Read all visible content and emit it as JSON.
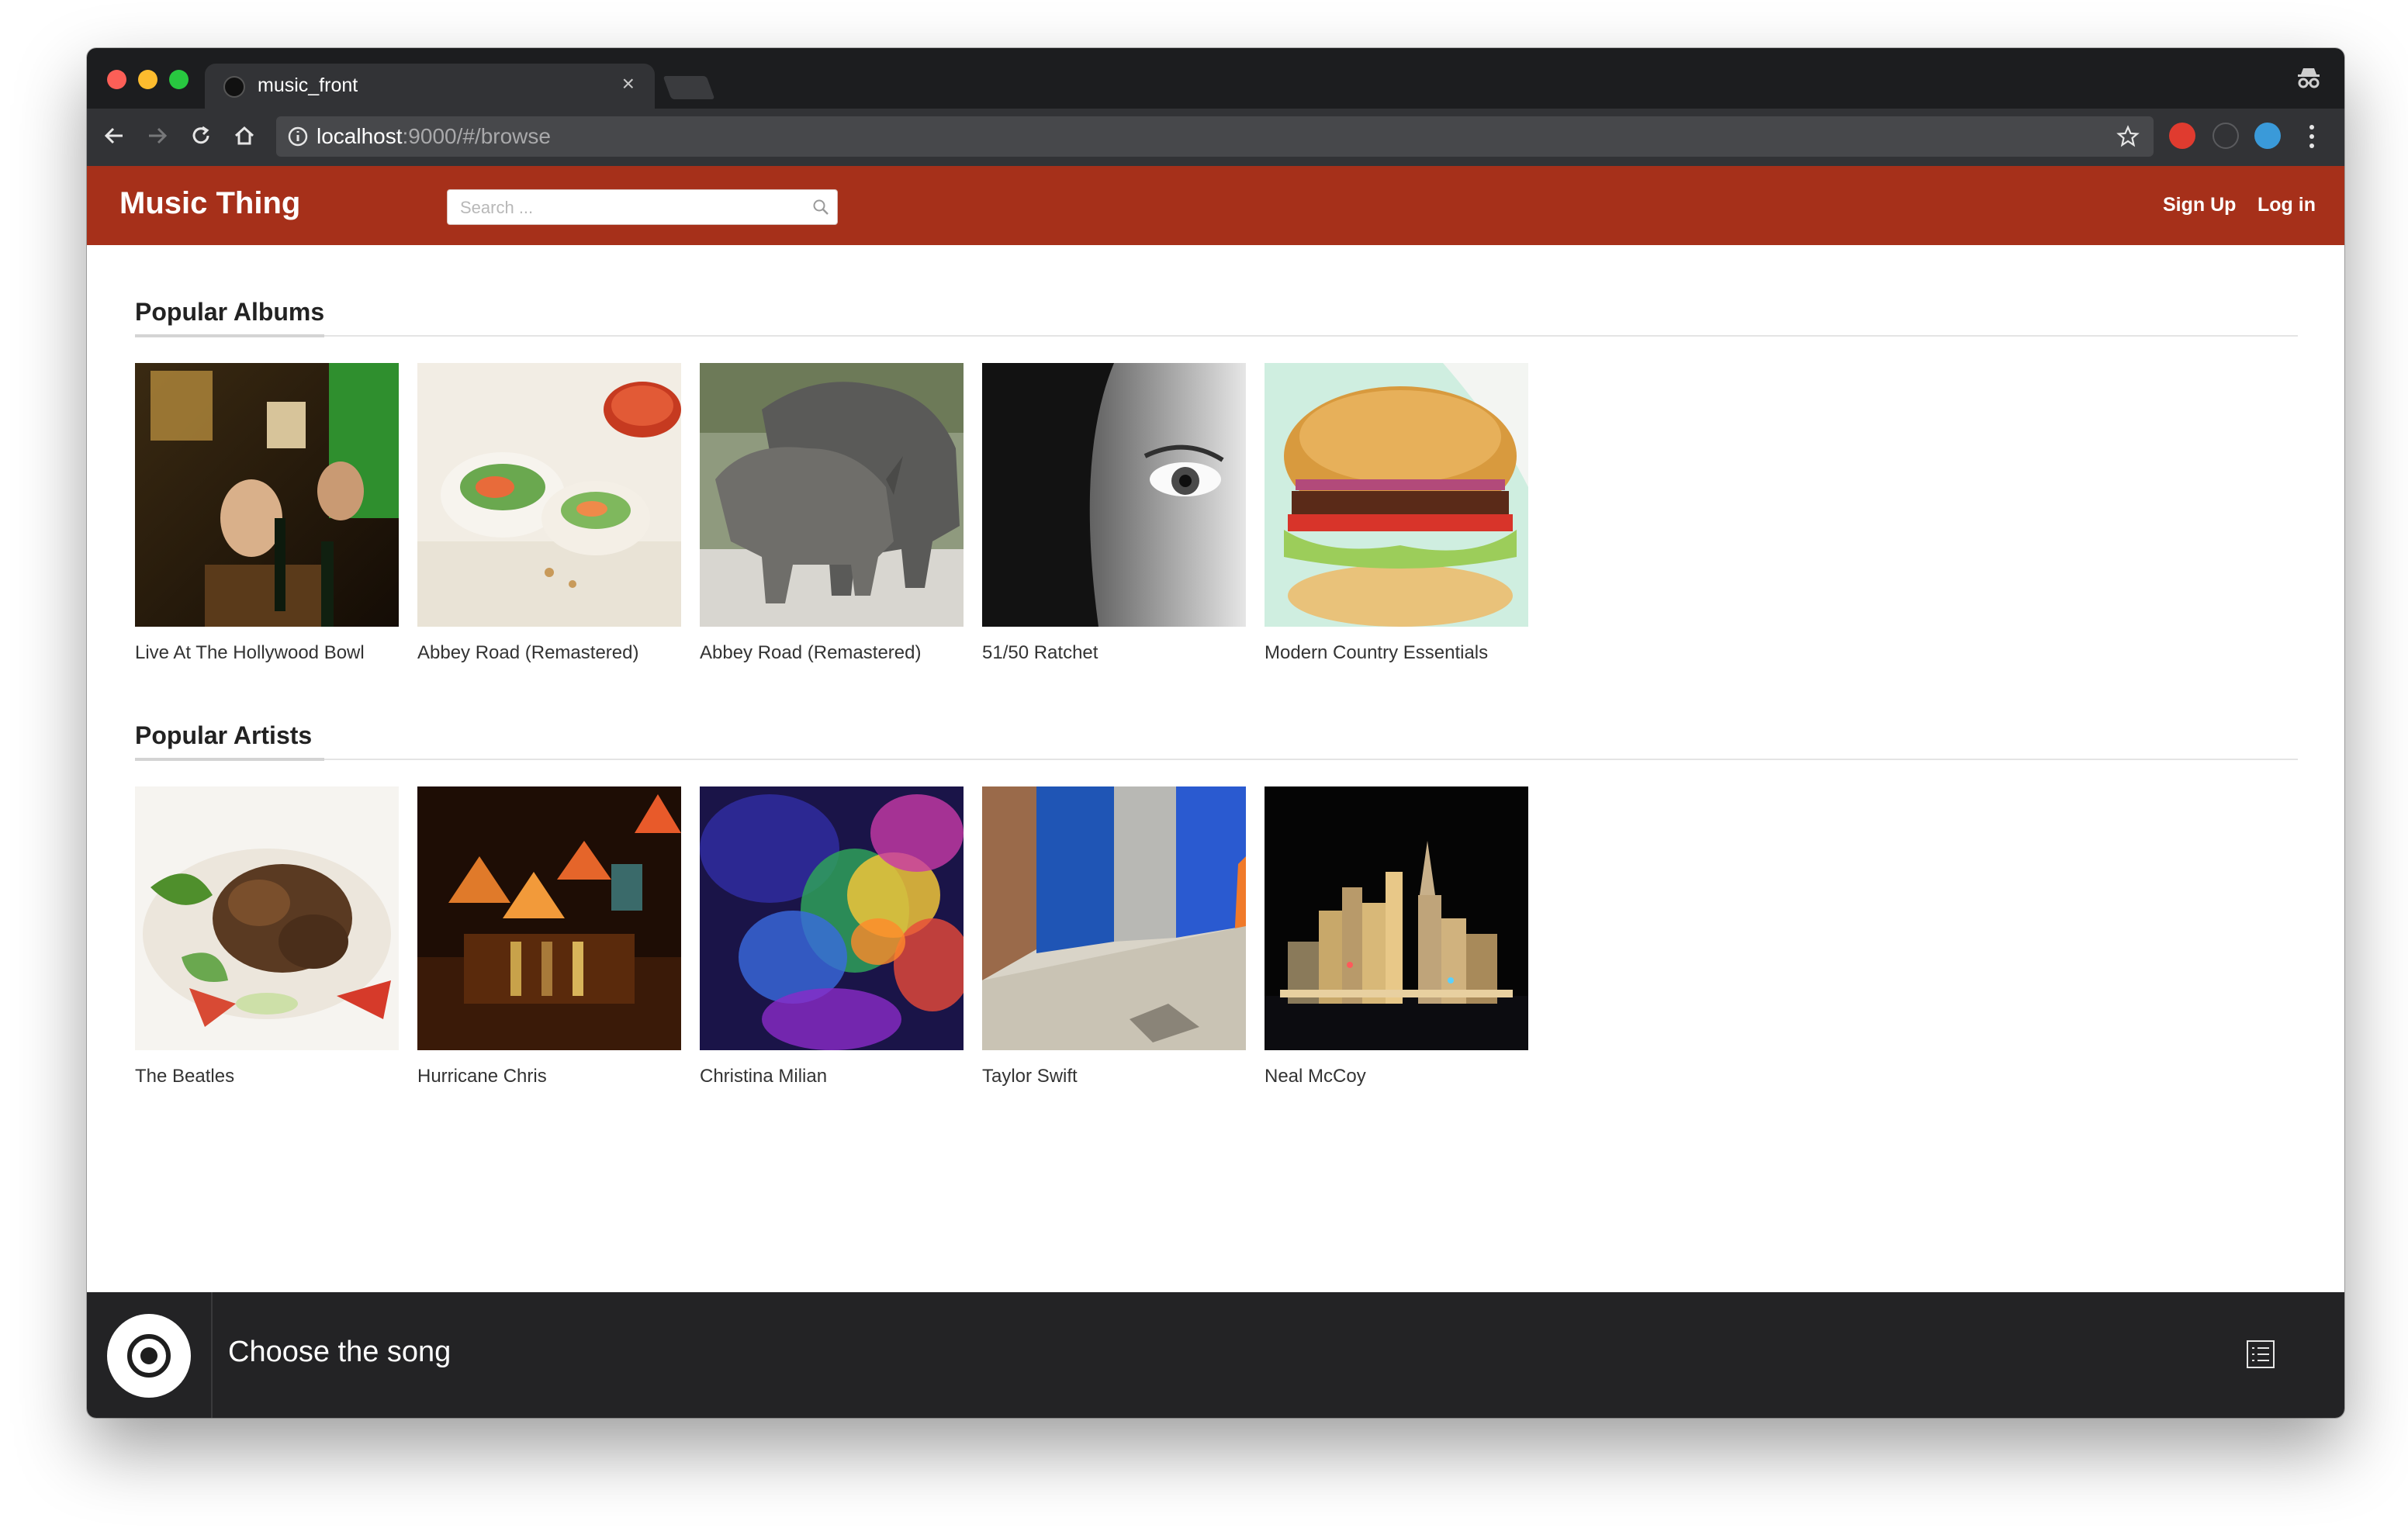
{
  "browser": {
    "tab_title": "music_front",
    "url_host": "localhost",
    "url_rest": ":9000/#/browse"
  },
  "header": {
    "brand": "Music Thing",
    "search_placeholder": "Search ...",
    "signup": "Sign Up",
    "login": "Log in",
    "accent_color": "#a6301a"
  },
  "albums": {
    "title": "Popular Albums",
    "items": [
      {
        "label": "Live At The Hollywood Bowl"
      },
      {
        "label": "Abbey Road (Remastered)"
      },
      {
        "label": "Abbey Road (Remastered)"
      },
      {
        "label": "51/50 Ratchet"
      },
      {
        "label": "Modern Country Essentials"
      }
    ]
  },
  "artists": {
    "title": "Popular Artists",
    "items": [
      {
        "label": "The Beatles"
      },
      {
        "label": "Hurricane Chris"
      },
      {
        "label": "Christina Milian"
      },
      {
        "label": "Taylor Swift"
      },
      {
        "label": "Neal McCoy"
      }
    ]
  },
  "player": {
    "status": "Choose the song"
  }
}
